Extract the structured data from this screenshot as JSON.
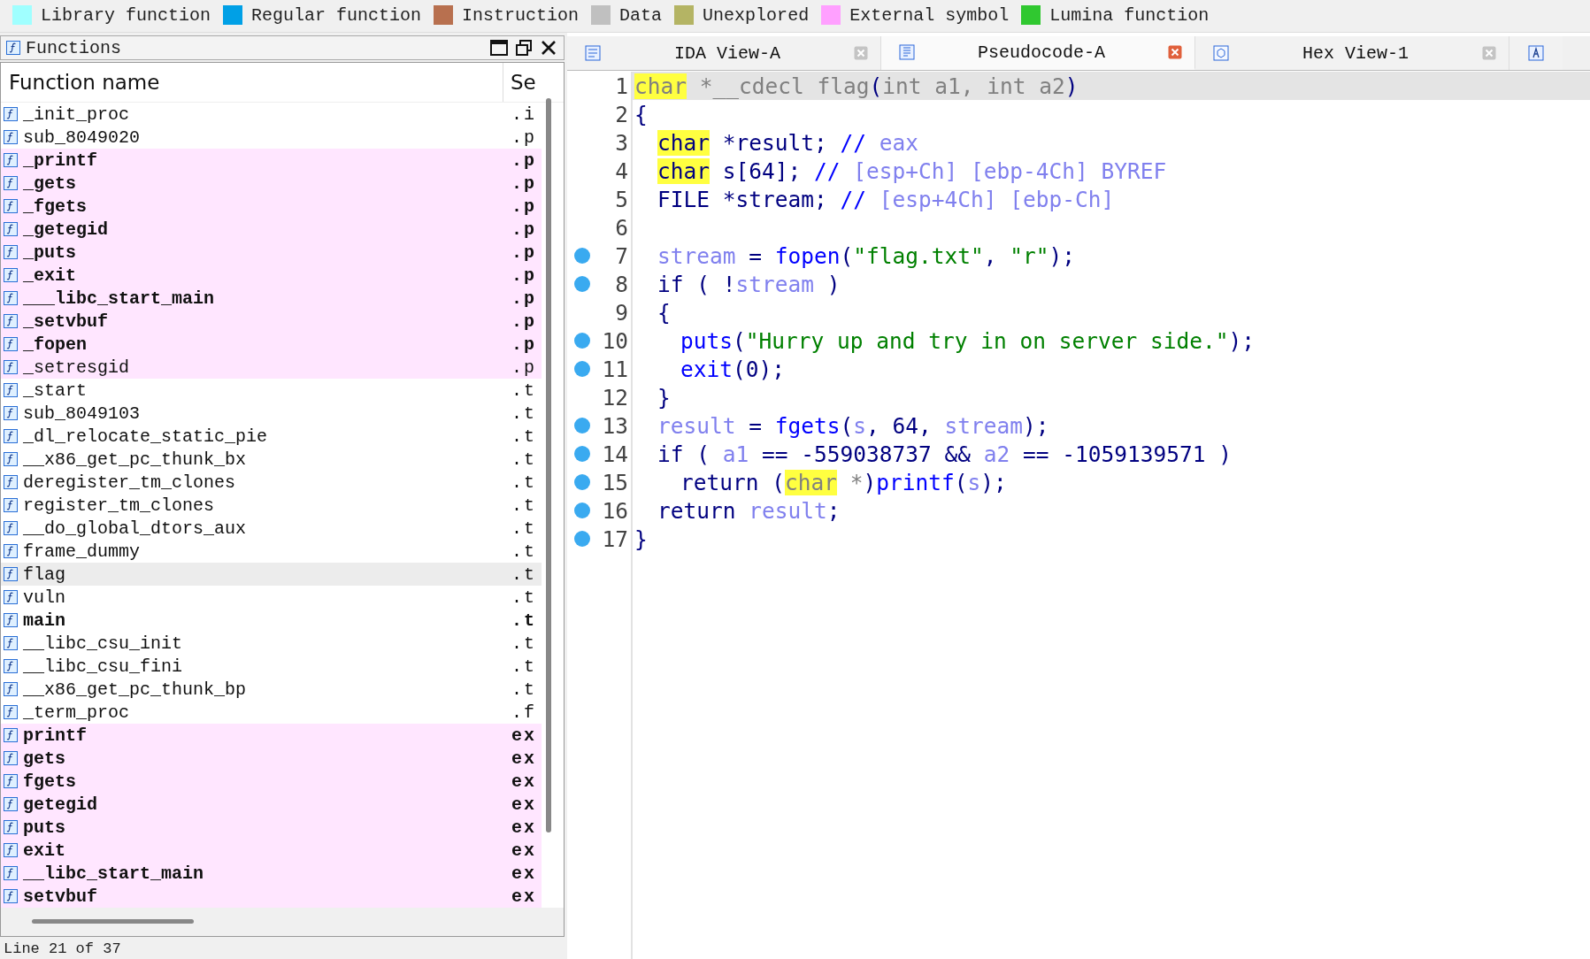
{
  "legend": [
    {
      "label": "Library function",
      "color": "#a0ffff"
    },
    {
      "label": "Regular function",
      "color": "#00a0e6"
    },
    {
      "label": "Instruction",
      "color": "#b8704f"
    },
    {
      "label": "Data",
      "color": "#c0c0c0"
    },
    {
      "label": "Unexplored",
      "color": "#b4b464"
    },
    {
      "label": "External symbol",
      "color": "#ffa0ff"
    },
    {
      "label": "Lumina function",
      "color": "#30c830"
    }
  ],
  "functions_panel": {
    "title": "Functions",
    "columns": [
      "Function name",
      "Se"
    ],
    "rows": [
      {
        "name": "_init_proc",
        "segment": ".i",
        "bold": false,
        "external": false,
        "selected": false
      },
      {
        "name": "sub_8049020",
        "segment": ".p",
        "bold": false,
        "external": false,
        "selected": false
      },
      {
        "name": "_printf",
        "segment": ".p",
        "bold": true,
        "external": true,
        "selected": false
      },
      {
        "name": "_gets",
        "segment": ".p",
        "bold": true,
        "external": true,
        "selected": false
      },
      {
        "name": "_fgets",
        "segment": ".p",
        "bold": true,
        "external": true,
        "selected": false
      },
      {
        "name": "_getegid",
        "segment": ".p",
        "bold": true,
        "external": true,
        "selected": false
      },
      {
        "name": "_puts",
        "segment": ".p",
        "bold": true,
        "external": true,
        "selected": false
      },
      {
        "name": "_exit",
        "segment": ".p",
        "bold": true,
        "external": true,
        "selected": false
      },
      {
        "name": "___libc_start_main",
        "segment": ".p",
        "bold": true,
        "external": true,
        "selected": false
      },
      {
        "name": "_setvbuf",
        "segment": ".p",
        "bold": true,
        "external": true,
        "selected": false
      },
      {
        "name": "_fopen",
        "segment": ".p",
        "bold": true,
        "external": true,
        "selected": false
      },
      {
        "name": "_setresgid",
        "segment": ".p",
        "bold": false,
        "external": true,
        "selected": false
      },
      {
        "name": "_start",
        "segment": ".t",
        "bold": false,
        "external": false,
        "selected": false
      },
      {
        "name": "sub_8049103",
        "segment": ".t",
        "bold": false,
        "external": false,
        "selected": false
      },
      {
        "name": "_dl_relocate_static_pie",
        "segment": ".t",
        "bold": false,
        "external": false,
        "selected": false
      },
      {
        "name": "__x86_get_pc_thunk_bx",
        "segment": ".t",
        "bold": false,
        "external": false,
        "selected": false
      },
      {
        "name": "deregister_tm_clones",
        "segment": ".t",
        "bold": false,
        "external": false,
        "selected": false
      },
      {
        "name": "register_tm_clones",
        "segment": ".t",
        "bold": false,
        "external": false,
        "selected": false
      },
      {
        "name": "__do_global_dtors_aux",
        "segment": ".t",
        "bold": false,
        "external": false,
        "selected": false
      },
      {
        "name": "frame_dummy",
        "segment": ".t",
        "bold": false,
        "external": false,
        "selected": false
      },
      {
        "name": "flag",
        "segment": ".t",
        "bold": false,
        "external": false,
        "selected": true
      },
      {
        "name": "vuln",
        "segment": ".t",
        "bold": false,
        "external": false,
        "selected": false
      },
      {
        "name": "main",
        "segment": ".t",
        "bold": true,
        "external": false,
        "selected": false
      },
      {
        "name": "__libc_csu_init",
        "segment": ".t",
        "bold": false,
        "external": false,
        "selected": false
      },
      {
        "name": "__libc_csu_fini",
        "segment": ".t",
        "bold": false,
        "external": false,
        "selected": false
      },
      {
        "name": "__x86_get_pc_thunk_bp",
        "segment": ".t",
        "bold": false,
        "external": false,
        "selected": false
      },
      {
        "name": "_term_proc",
        "segment": ".f",
        "bold": false,
        "external": false,
        "selected": false
      },
      {
        "name": "printf",
        "segment": "ex",
        "bold": true,
        "external": true,
        "selected": false
      },
      {
        "name": "gets",
        "segment": "ex",
        "bold": true,
        "external": true,
        "selected": false
      },
      {
        "name": "fgets",
        "segment": "ex",
        "bold": true,
        "external": true,
        "selected": false
      },
      {
        "name": "getegid",
        "segment": "ex",
        "bold": true,
        "external": true,
        "selected": false
      },
      {
        "name": "puts",
        "segment": "ex",
        "bold": true,
        "external": true,
        "selected": false
      },
      {
        "name": "exit",
        "segment": "ex",
        "bold": true,
        "external": true,
        "selected": false
      },
      {
        "name": "__libc_start_main",
        "segment": "ex",
        "bold": true,
        "external": true,
        "selected": false
      },
      {
        "name": "setvbuf",
        "segment": "ex",
        "bold": true,
        "external": true,
        "selected": false
      }
    ],
    "status": "Line 21 of 37"
  },
  "tabs": [
    {
      "label": "IDA View-A",
      "selected": false
    },
    {
      "label": "Pseudocode-A",
      "selected": true
    },
    {
      "label": "Hex View-1",
      "selected": false
    }
  ],
  "code_lines": [
    {
      "number": "1",
      "breakpoint": false,
      "current": true,
      "tokens": [
        {
          "text": "char",
          "kind": "type-dim"
        },
        {
          "text": " *__cdecl flag",
          "kind": "dim"
        },
        {
          "text": "(",
          "kind": "plain"
        },
        {
          "text": "int a1, int a2",
          "kind": "dim"
        },
        {
          "text": ")",
          "kind": "plain"
        }
      ]
    },
    {
      "number": "2",
      "breakpoint": false,
      "current": false,
      "tokens": [
        {
          "text": "{",
          "kind": "plain"
        }
      ],
      "children": [
        {
          "number": "3",
          "breakpoint": false,
          "current": false,
          "tokens": [
            {
              "text": "char",
              "kind": "type"
            },
            {
              "text": " *result; ",
              "kind": "plain"
            },
            {
              "text": "// ",
              "kind": "comment"
            },
            {
              "text": "eax",
              "kind": "var"
            }
          ]
        },
        {
          "number": "4",
          "breakpoint": false,
          "current": false,
          "tokens": [
            {
              "text": "char",
              "kind": "type"
            },
            {
              "text": " s[64]; ",
              "kind": "plain"
            },
            {
              "text": "// ",
              "kind": "comment"
            },
            {
              "text": "[esp+Ch] [ebp-4Ch] BYREF",
              "kind": "var"
            }
          ]
        },
        {
          "number": "5",
          "breakpoint": false,
          "current": false,
          "tokens": [
            {
              "text": "FILE *stream; ",
              "kind": "plain"
            },
            {
              "text": "// ",
              "kind": "comment"
            },
            {
              "text": "[esp+4Ch] [ebp-Ch]",
              "kind": "var"
            }
          ]
        },
        {
          "number": "6",
          "breakpoint": false,
          "current": false
        },
        {
          "number": "7",
          "breakpoint": true,
          "current": false,
          "tokens": [
            {
              "text": "stream",
              "kind": "var"
            },
            {
              "text": " = ",
              "kind": "plain"
            },
            {
              "text": "fopen",
              "kind": "func"
            },
            {
              "text": "(",
              "kind": "plain"
            },
            {
              "text": "\"flag.txt\"",
              "kind": "string"
            },
            {
              "text": ", ",
              "kind": "plain"
            },
            {
              "text": "\"r\"",
              "kind": "string"
            },
            {
              "text": ");",
              "kind": "plain"
            }
          ]
        },
        {
          "number": "8",
          "breakpoint": true,
          "current": false,
          "tokens": [
            {
              "text": "if ( !",
              "kind": "plain"
            },
            {
              "text": "stream",
              "kind": "var"
            },
            {
              "text": " )",
              "kind": "plain"
            }
          ]
        },
        {
          "number": "9",
          "breakpoint": false,
          "current": false,
          "tokens": [
            {
              "text": "{",
              "kind": "plain"
            }
          ],
          "children": [
            {
              "number": "10",
              "breakpoint": true,
              "current": false,
              "tokens": [
                {
                  "text": "puts",
                  "kind": "func"
                },
                {
                  "text": "(",
                  "kind": "plain"
                },
                {
                  "text": "\"Hurry up and try in on server side.\"",
                  "kind": "string"
                },
                {
                  "text": ");",
                  "kind": "plain"
                }
              ]
            },
            {
              "number": "11",
              "breakpoint": true,
              "current": false,
              "tokens": [
                {
                  "text": "exit",
                  "kind": "func"
                },
                {
                  "text": "(0);",
                  "kind": "plain"
                }
              ]
            }
          ]
        },
        {
          "number": "12",
          "breakpoint": false,
          "current": false,
          "tokens": [
            {
              "text": "}",
              "kind": "plain"
            }
          ]
        },
        {
          "number": "13",
          "breakpoint": true,
          "current": false,
          "tokens": [
            {
              "text": "result",
              "kind": "var"
            },
            {
              "text": " = ",
              "kind": "plain"
            },
            {
              "text": "fgets",
              "kind": "func"
            },
            {
              "text": "(",
              "kind": "plain"
            },
            {
              "text": "s",
              "kind": "var"
            },
            {
              "text": ", 64, ",
              "kind": "plain"
            },
            {
              "text": "stream",
              "kind": "var"
            },
            {
              "text": ");",
              "kind": "plain"
            }
          ]
        },
        {
          "number": "14",
          "breakpoint": true,
          "current": false,
          "tokens": [
            {
              "text": "if ( ",
              "kind": "plain"
            },
            {
              "text": "a1",
              "kind": "var"
            },
            {
              "text": " == -559038737 && ",
              "kind": "plain"
            },
            {
              "text": "a2",
              "kind": "var"
            },
            {
              "text": " == -1059139571 )",
              "kind": "plain"
            }
          ],
          "children": [
            {
              "number": "15",
              "breakpoint": true,
              "current": false,
              "tokens": [
                {
                  "text": "return (",
                  "kind": "plain"
                },
                {
                  "text": "char",
                  "kind": "type-dim"
                },
                {
                  "text": " *",
                  "kind": "dim"
                },
                {
                  "text": ")",
                  "kind": "plain"
                },
                {
                  "text": "printf",
                  "kind": "func"
                },
                {
                  "text": "(",
                  "kind": "plain"
                },
                {
                  "text": "s",
                  "kind": "var"
                },
                {
                  "text": ");",
                  "kind": "plain"
                }
              ]
            }
          ]
        },
        {
          "number": "16",
          "breakpoint": true,
          "current": false,
          "tokens": [
            {
              "text": "return ",
              "kind": "plain"
            },
            {
              "text": "result",
              "kind": "var"
            },
            {
              "text": ";",
              "kind": "plain"
            }
          ]
        }
      ]
    },
    {
      "number": "17",
      "breakpoint": true,
      "current": false,
      "tokens": [
        {
          "text": "}",
          "kind": "plain"
        }
      ]
    }
  ]
}
